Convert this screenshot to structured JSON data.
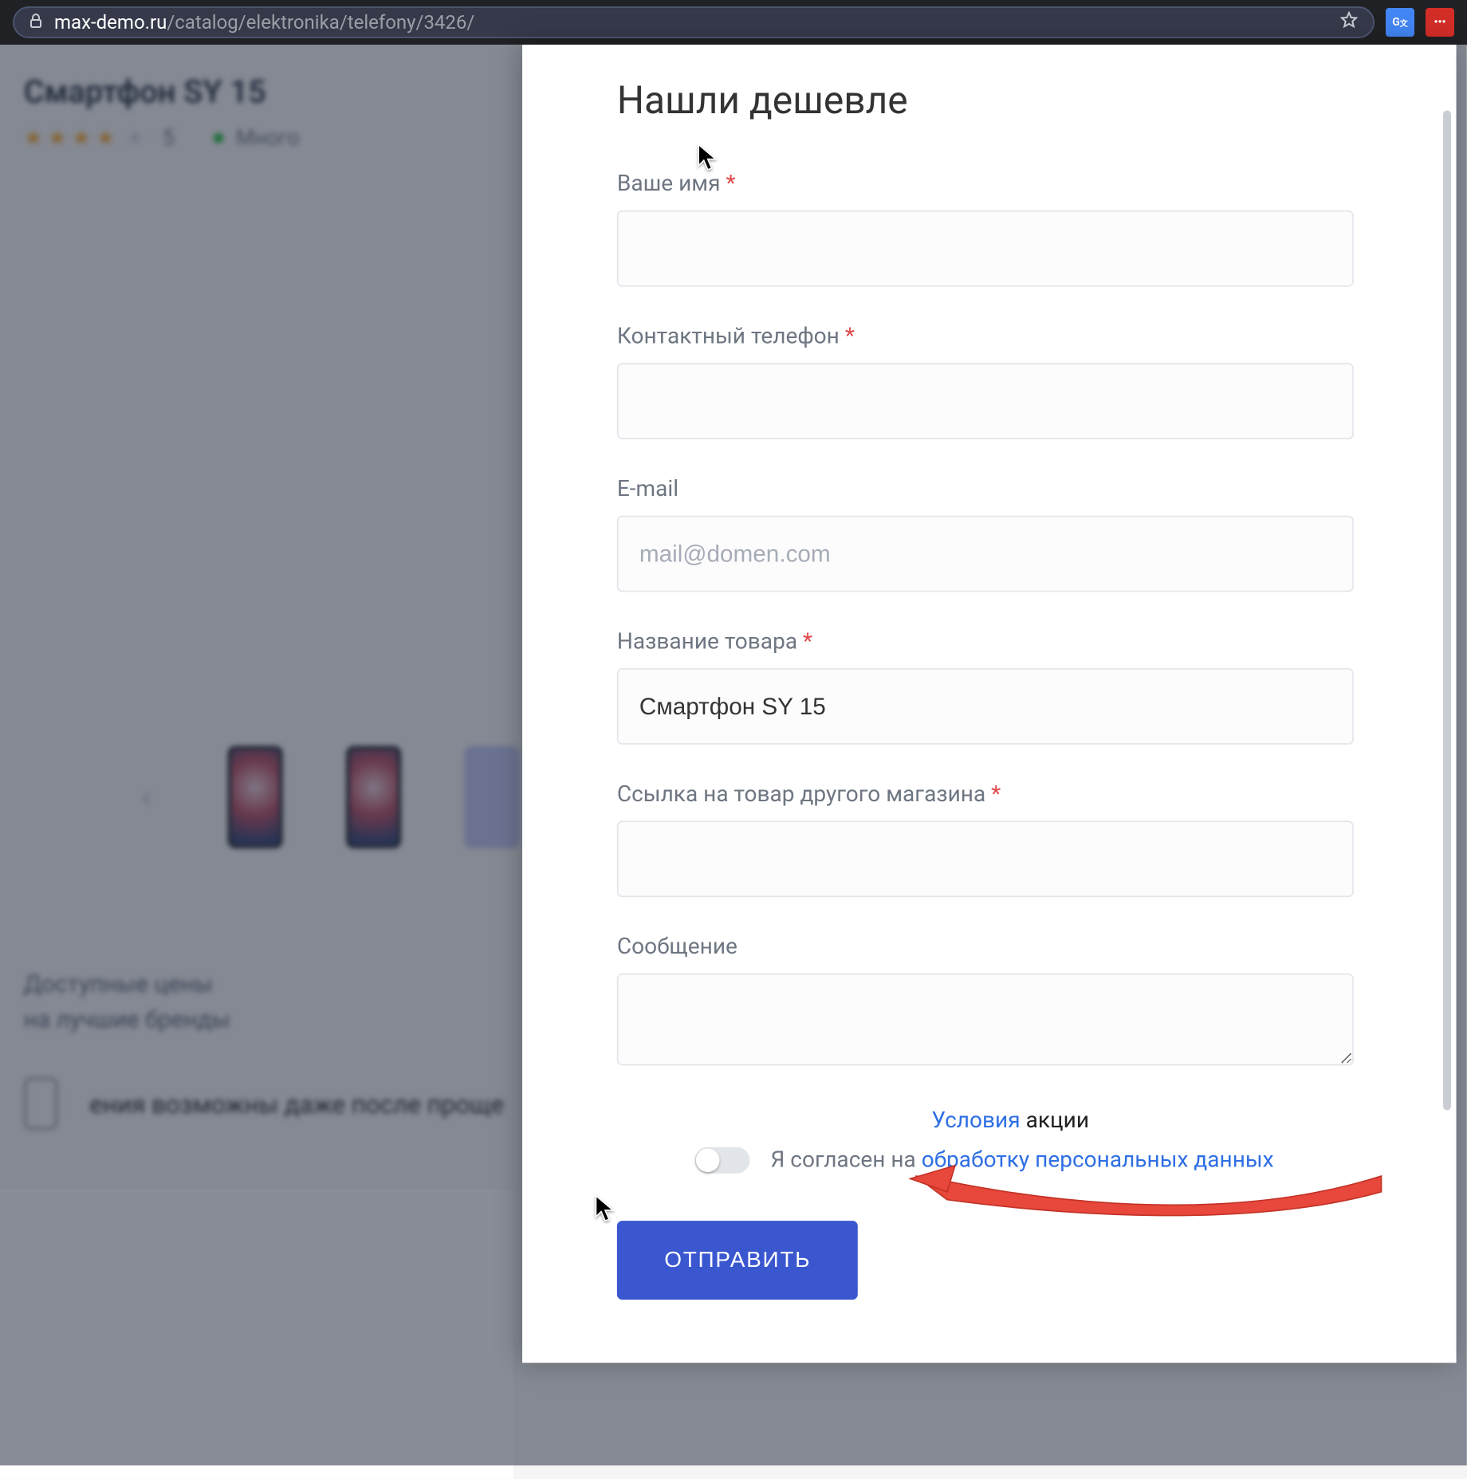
{
  "browser": {
    "domain": "max-demo.ru",
    "path": "/catalog/elektronika/telefony/3426/"
  },
  "backdrop": {
    "title": "Смартфон SY 15",
    "rating_value": "5",
    "stock": "Много",
    "promo_line1": "Доступные цены",
    "promo_line2": "на лучшие бренды",
    "banner": "ения возможны даже после проще"
  },
  "modal": {
    "title": "Нашли дешевле",
    "fields": {
      "name_label": "Ваше имя",
      "phone_label": "Контактный телефон",
      "email_label": "E-mail",
      "email_placeholder": "mail@domen.com",
      "product_label": "Название товара",
      "product_value": "Смартфон SY 15",
      "link_label": "Ссылка на товар другого магазина",
      "message_label": "Сообщение"
    },
    "terms": {
      "link1": "Условия",
      "link2": "акции",
      "consent_prefix": "Я согласен на ",
      "consent_link": "обработку персональных данных"
    },
    "submit": "ОТПРАВИТЬ"
  }
}
